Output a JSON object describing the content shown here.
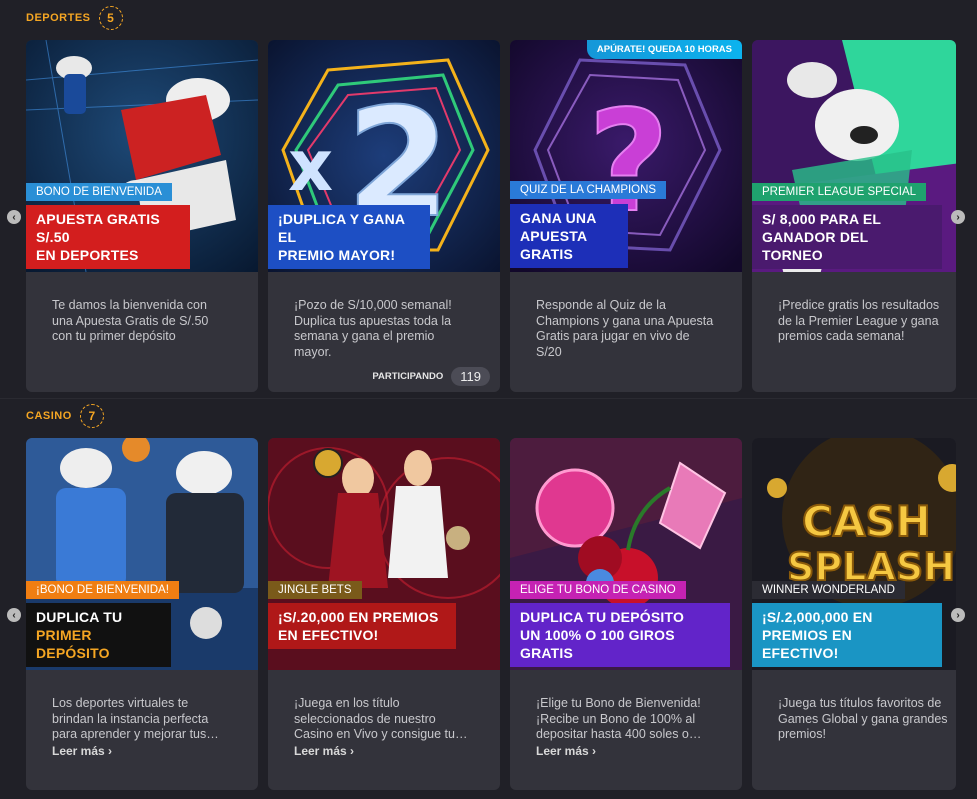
{
  "deportes": {
    "title": "Deportes",
    "count": "5",
    "cards": [
      {
        "category": "BONO DE BIENVENIDA",
        "category_color": "#2a8fd6",
        "headline_lines": [
          "APUESTA GRATIS S/.50",
          "EN DEPORTES"
        ],
        "headline_color": "#d31e1e",
        "description_lines": [
          "Te damos la bienvenida con",
          "una Apuesta Gratis de S/.50",
          "con tu primer depósito"
        ]
      },
      {
        "headline_lines": [
          "¡DUPLICA Y GANA EL",
          "PREMIO MAYOR!"
        ],
        "headline_color": "#1d4fc4",
        "description_lines": [
          "¡Pozo de S/10,000 semanal!",
          "Duplica tus apuestas toda la",
          "semana y gana el premio",
          "mayor."
        ],
        "participating_label": "PARTICIPANDO",
        "participating_count": "119"
      },
      {
        "urgency": "APÚRATE! QUEDA 10 HORAS",
        "category": "QUIZ DE LA CHAMPIONS",
        "category_color": "#2a7ad8",
        "headline_lines": [
          "GANA UNA",
          "APUESTA GRATIS"
        ],
        "headline_color": "#1d2fb8",
        "description_lines": [
          "Responde al Quiz de la",
          "Champions y gana una Apuesta",
          "Gratis para jugar en vivo de",
          "S/20"
        ]
      },
      {
        "category": "PREMIER LEAGUE SPECIAL",
        "category_color": "#1fa26e",
        "headline_lines": [
          "S/ 8,000 PARA EL",
          "GANADOR DEL TORNEO"
        ],
        "headline_color": "#4a1a6e",
        "description_lines": [
          "¡Predice gratis los resultados",
          "de la Premier League y gana",
          "premios cada semana!"
        ]
      }
    ]
  },
  "casino": {
    "title": "Casino",
    "count": "7",
    "cards": [
      {
        "category": "¡BONO DE BIENVENIDA!",
        "category_color": "#f07e12",
        "headline_lines": [
          "DUPLICA TU",
          "PRIMER DEPÓSITO"
        ],
        "headline_color": "#111111",
        "description_lines": [
          "Los deportes virtuales te",
          "brindan la instancia perfecta",
          "para aprender y mejorar tus…"
        ],
        "read_more": "Leer más ›"
      },
      {
        "category": "JINGLE BETS",
        "category_color": "#7a5a1a",
        "headline_lines": [
          "¡S/.20,000 EN PREMIOS",
          "EN EFECTIVO!"
        ],
        "headline_color": "#b01818",
        "description_lines": [
          "¡Juega en los título",
          "seleccionados de nuestro",
          "Casino en Vivo y consigue tu…"
        ],
        "read_more": "Leer más ›"
      },
      {
        "category": "ELIGE TU BONO DE CASINO",
        "category_color": "#c522b3",
        "headline_lines": [
          "DUPLICA TU DEPÓSITO",
          "UN 100% O 100 GIROS GRATIS"
        ],
        "headline_color": "#6224c9",
        "description_lines": [
          "¡Elige tu Bono de Bienvenida!",
          "¡Recibe un Bono de 100% al",
          "depositar hasta 400 soles o…"
        ],
        "read_more": "Leer más ›"
      },
      {
        "category": "WINNER WONDERLAND",
        "category_color": "#2b2b33",
        "headline_lines": [
          "¡S/.2,000,000 EN",
          "PREMIOS EN EFECTIVO!"
        ],
        "headline_color": "#1a95c4",
        "description_lines": [
          "¡Juega tus títulos favoritos de",
          "Games Global y gana grandes",
          "premios!"
        ],
        "read_more": ""
      }
    ]
  },
  "art_text": {
    "x2_letter": "x",
    "x2_digit": "2",
    "question_mark": "?",
    "cash_top": "CASH",
    "cash_bottom": "SPLASH"
  },
  "icons": {
    "arrow_left": "‹",
    "arrow_right": "›"
  }
}
